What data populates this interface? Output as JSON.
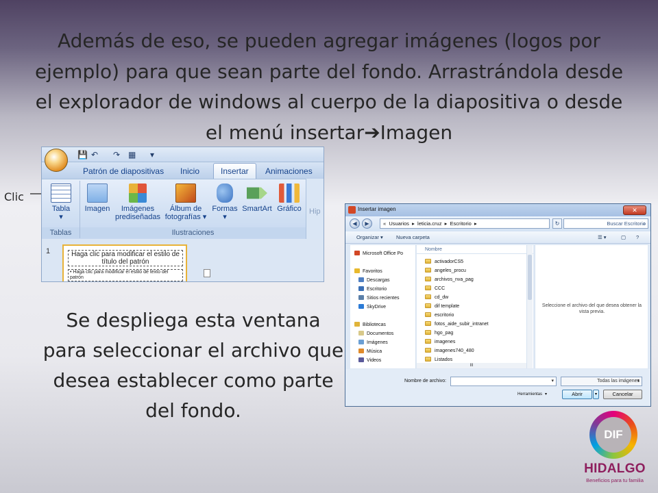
{
  "slide": {
    "title_before_arrow": "Además de eso, se pueden agregar imágenes (logos por ejemplo) para que sean parte del fondo. Arrastrándola desde el explorador de windows al cuerpo de la diapositiva o desde el menú insertar",
    "title_after_arrow": "Imagen",
    "body": "Se despliega esta ventana para seleccionar el archivo que desea establecer como parte del fondo.",
    "callout_label": "Clic"
  },
  "ribbon": {
    "tabs": [
      "Patrón de diapositivas",
      "Inicio",
      "Insertar",
      "Animaciones"
    ],
    "active_tab": "Insertar",
    "groups": {
      "tablas": "Tablas",
      "ilustraciones": "Ilustraciones"
    },
    "buttons": {
      "tabla": "Tabla",
      "imagen": "Imagen",
      "imagenes_line1": "Imágenes",
      "imagenes_line2": "prediseñadas",
      "album_line1": "Álbum de",
      "album_line2": "fotografías",
      "formas": "Formas",
      "smartart": "SmartArt",
      "grafico": "Gráfico",
      "partial": "Hip"
    },
    "thumbnail": {
      "number": "1",
      "title_placeholder": "Haga clic para modificar el estilo de título del patrón",
      "body_placeholder": "• Haga clic para modificar el estilo de texto del patrón"
    }
  },
  "dialog": {
    "title": "Insertar imagen",
    "close": "✕",
    "address_path": "«  Usuarios  ▸  leticia.cruz  ▸  Escritorio  ▸",
    "search_placeholder": "Buscar Escritorio",
    "toolbar": {
      "organize": "Organizar ▾",
      "new_folder": "Nueva carpeta"
    },
    "nav_items": [
      {
        "label": "Microsoft Office Po",
        "color": "#d24726"
      },
      {
        "label": "Favoritos",
        "color": "#e8b92e"
      },
      {
        "label": "Descargas",
        "color": "#4f7fc2"
      },
      {
        "label": "Escritorio",
        "color": "#3a6fb5"
      },
      {
        "label": "Sitios recientes",
        "color": "#5b7fa8"
      },
      {
        "label": "SkyDrive",
        "color": "#2c7bd6"
      },
      {
        "label": "Bibliotecas",
        "color": "#e0b43a"
      },
      {
        "label": "Documentos",
        "color": "#d8c98a"
      },
      {
        "label": "Imágenes",
        "color": "#6b9fd4"
      },
      {
        "label": "Música",
        "color": "#e08a2a"
      },
      {
        "label": "Videos",
        "color": "#5a5a9a"
      }
    ],
    "column_header": "Nombre",
    "files": [
      "activadorCS5",
      "angeles_procu",
      "archivos_nva_pag",
      "CCC",
      "cd_dw",
      "dif template",
      "escritorio",
      "fotos_aide_subir_intranet",
      "hgo_pag",
      "imagenes",
      "imagenes740_480",
      "Listados"
    ],
    "hscroll_thumb": "III",
    "preview_text": "Seleccione el archivo del que desea obtener la vista previa.",
    "filename_label": "Nombre de archivo:",
    "filter": "Todas las imágenes",
    "tools": "Herramientas",
    "open": "Abrir",
    "cancel": "Cancelar"
  },
  "logo": {
    "initials": "DIF",
    "name": "HIDALGO",
    "tagline": "Beneficios para tu familia"
  }
}
